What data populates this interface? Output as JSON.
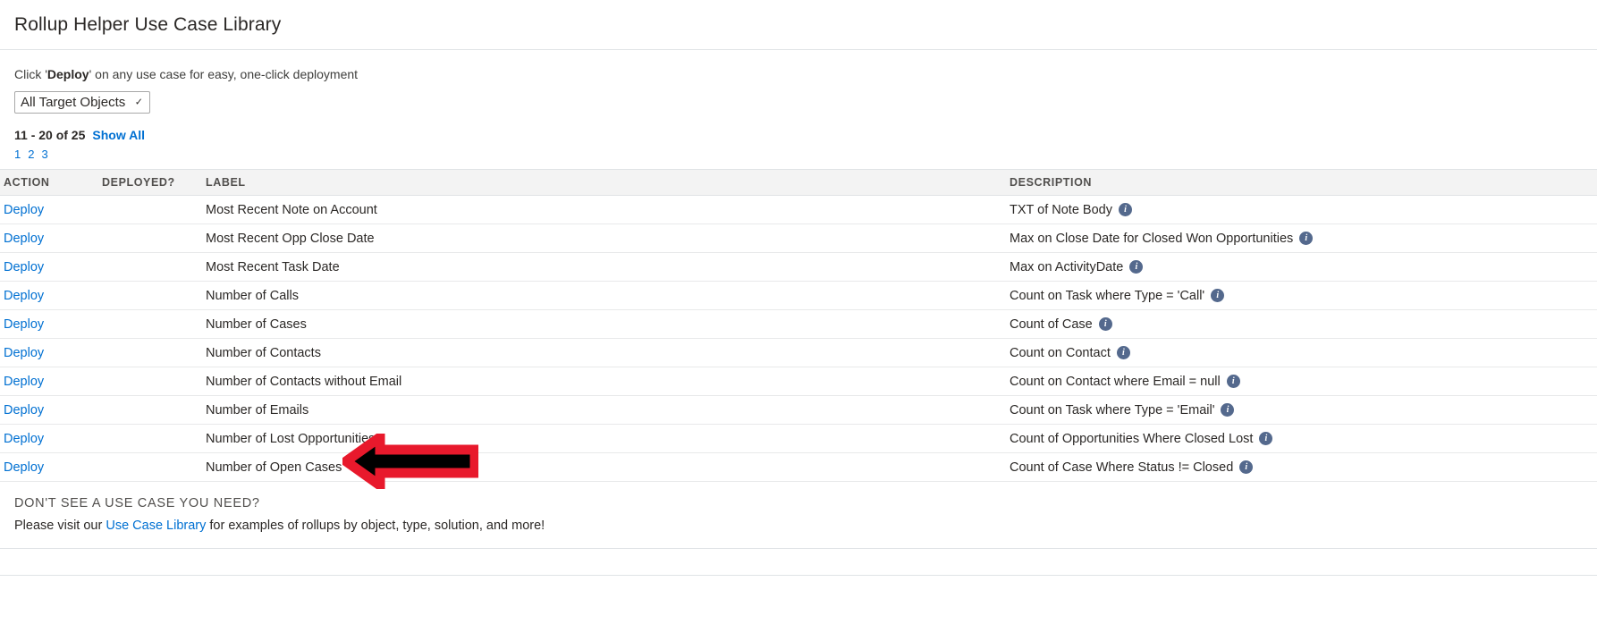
{
  "header": {
    "title": "Rollup Helper Use Case Library"
  },
  "intro": {
    "prefix": "Click '",
    "emphasis": "Deploy",
    "suffix": "' on any use case for easy, one-click deployment"
  },
  "filter": {
    "selected": "All Target Objects",
    "options": [
      "All Target Objects"
    ],
    "caret_icon": "chevron-down-icon"
  },
  "pagination": {
    "range_label": "11 - 20 of 25",
    "show_all_label": "Show All",
    "pages": [
      "1",
      "2",
      "3"
    ],
    "current_page": "1"
  },
  "table": {
    "columns": [
      "ACTION",
      "DEPLOYED?",
      "LABEL",
      "DESCRIPTION"
    ],
    "action_label": "Deploy",
    "info_icon_glyph": "i",
    "rows": [
      {
        "action": "Deploy",
        "deployed": "",
        "label": "Most Recent Note on Account",
        "description": "TXT of Note Body"
      },
      {
        "action": "Deploy",
        "deployed": "",
        "label": "Most Recent Opp Close Date",
        "description": "Max on Close Date for Closed Won Opportunities"
      },
      {
        "action": "Deploy",
        "deployed": "",
        "label": "Most Recent Task Date",
        "description": "Max on ActivityDate"
      },
      {
        "action": "Deploy",
        "deployed": "",
        "label": "Number of Calls",
        "description": "Count on Task where Type = 'Call'"
      },
      {
        "action": "Deploy",
        "deployed": "",
        "label": "Number of Cases",
        "description": "Count of Case"
      },
      {
        "action": "Deploy",
        "deployed": "",
        "label": "Number of Contacts",
        "description": "Count on Contact"
      },
      {
        "action": "Deploy",
        "deployed": "",
        "label": "Number of Contacts without Email",
        "description": "Count on Contact where Email = null"
      },
      {
        "action": "Deploy",
        "deployed": "",
        "label": "Number of Emails",
        "description": "Count on Task where Type = 'Email'"
      },
      {
        "action": "Deploy",
        "deployed": "",
        "label": "Number of Lost Opportunities",
        "description": "Count of Opportunities Where Closed Lost"
      },
      {
        "action": "Deploy",
        "deployed": "",
        "label": "Number of Open Cases",
        "description": "Count of Case Where Status != Closed"
      }
    ]
  },
  "footer": {
    "heading": "DON'T SEE A USE CASE YOU NEED?",
    "body_prefix": "Please visit our ",
    "link_label": "Use Case Library",
    "body_suffix": " for examples of rollups by object, type, solution, and more!"
  },
  "annotation": {
    "arrow_icon": "left-arrow-annotation-icon",
    "fill_color": "#000000",
    "outline_color": "#e8192c",
    "points_at": "Number of Open Cases"
  },
  "colors": {
    "link": "#0070d2",
    "text": "#2b2826",
    "header_bg": "#f3f3f3",
    "border": "#e0e3e6",
    "info_badge": "#54698d"
  }
}
